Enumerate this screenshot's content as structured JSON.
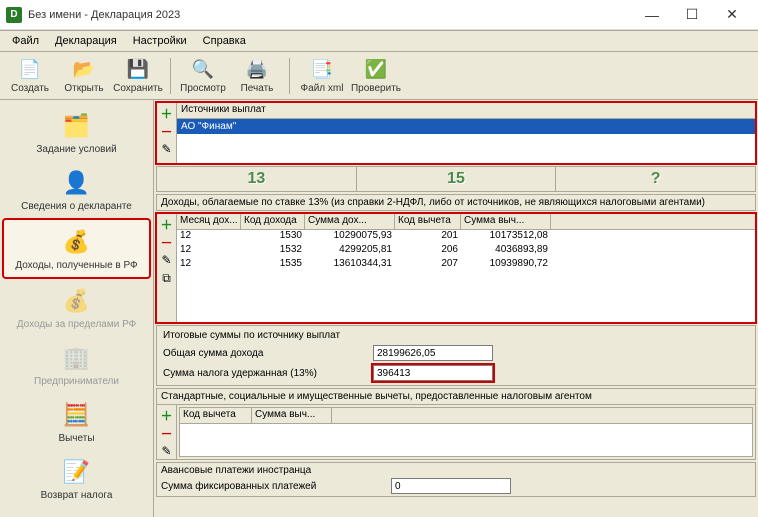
{
  "window": {
    "title": "Без имени - Декларация 2023"
  },
  "menu": {
    "file": "Файл",
    "decl": "Декларация",
    "settings": "Настройки",
    "help": "Справка"
  },
  "toolbar": {
    "create": "Создать",
    "open": "Открыть",
    "save": "Сохранить",
    "preview": "Просмотр",
    "print": "Печать",
    "xml": "Файл xml",
    "check": "Проверить"
  },
  "sidebar": {
    "conditions": "Задание условий",
    "declarant": "Сведения о декларанте",
    "income_rf": "Доходы, полученные в РФ",
    "income_abroad": "Доходы за пределами РФ",
    "entrepreneurs": "Предприниматели",
    "deductions": "Вычеты",
    "refund": "Возврат налога"
  },
  "sources": {
    "header": "Источники выплат",
    "item": "АО \"Финам\""
  },
  "rates": {
    "r13": "13",
    "r15": "15",
    "rq": "?"
  },
  "income_section": {
    "title": "Доходы, облагаемые по ставке 13% (из справки 2-НДФЛ, либо от источников, не являющихся налоговыми агентами)",
    "cols": {
      "month": "Месяц дох...",
      "code": "Код дохода",
      "sum": "Сумма дох...",
      "dedcode": "Код вычета",
      "dedsum": "Сумма выч..."
    },
    "rows": [
      {
        "month": "12",
        "code": "1530",
        "sum": "10290075,93",
        "dedcode": "201",
        "dedsum": "10173512,08"
      },
      {
        "month": "12",
        "code": "1532",
        "sum": "4299205,81",
        "dedcode": "206",
        "dedsum": "4036893,89"
      },
      {
        "month": "12",
        "code": "1535",
        "sum": "13610344,31",
        "dedcode": "207",
        "dedsum": "10939890,72"
      }
    ]
  },
  "totals": {
    "title": "Итоговые суммы по источнику выплат",
    "total_income_label": "Общая сумма дохода",
    "total_income_value": "28199626,05",
    "tax_withheld_label": "Сумма налога удержанная (13%)",
    "tax_withheld_value": "396413"
  },
  "deductions_panel": {
    "title": "Стандартные, социальные и имущественные вычеты, предоставленные налоговым агентом",
    "cols": {
      "code": "Код вычета",
      "sum": "Сумма выч..."
    }
  },
  "advance": {
    "title": "Авансовые платежи иностранца",
    "fixed_label": "Сумма фиксированных платежей",
    "fixed_value": "0"
  }
}
